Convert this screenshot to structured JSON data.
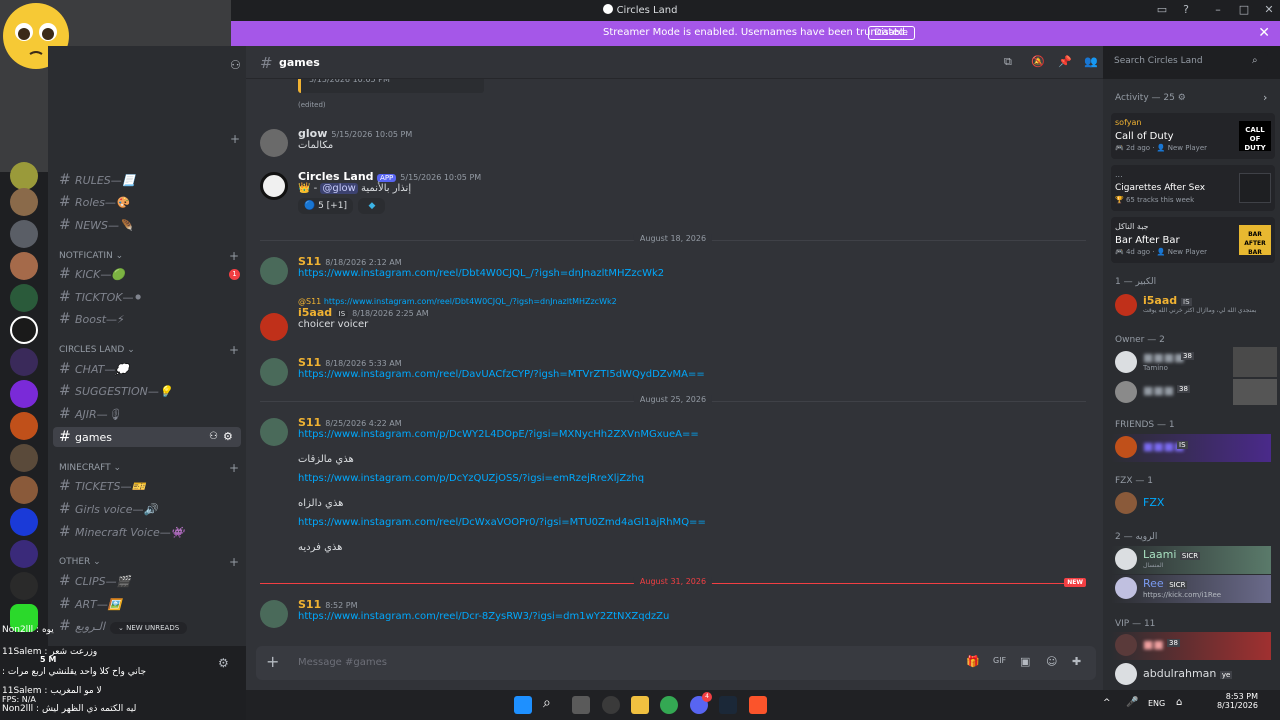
{
  "window": {
    "title": "Circles Land"
  },
  "banner": {
    "text": "Streamer Mode is enabled. Usernames have been truncated.",
    "button": "Disable"
  },
  "channel_list": {
    "categories": [
      {
        "name": "NOTFICATIN"
      },
      {
        "name": "CIRCLES LAND"
      },
      {
        "name": "MINECRAFT"
      },
      {
        "name": "OTHER"
      }
    ],
    "channels": [
      {
        "label": "RULES—📃"
      },
      {
        "label": "Roles—🎨"
      },
      {
        "label": "NEWS—🪶"
      },
      {
        "label": "KICK—🟢"
      },
      {
        "label": "TICKTOK—⚫"
      },
      {
        "label": "Boost—⚡"
      },
      {
        "label": "CHAT—💭"
      },
      {
        "label": "SUGGESTION—💡"
      },
      {
        "label": "AJIR—🎙"
      },
      {
        "label": "games"
      },
      {
        "label": "TICKETS—🎫"
      },
      {
        "label": "Girls voice—🔊"
      },
      {
        "label": "Minecraft Voice—👾"
      },
      {
        "label": "CLIPS—🎬"
      },
      {
        "label": "ART—🖼️"
      },
      {
        "label": "الـروبع"
      }
    ],
    "kick_badge": "1",
    "new_unreads": "NEW UNREADS"
  },
  "header": {
    "channel": "games",
    "search_placeholder": "Search Circles Land"
  },
  "messages": {
    "top_ts": "5/15/2026 10:05 PM",
    "edited": "(edited)",
    "m1": {
      "user": "glow",
      "ts": "5/15/2026 10:05 PM",
      "text": "مكالمات"
    },
    "m2": {
      "user": "Circles Land",
      "tag": "APP",
      "ts": "5/15/2026 10:05 PM",
      "text_mention": "@glow",
      "text_end": "إنذار بالأنمية",
      "reaction_count": "5 [+1]"
    },
    "div1": "August 18, 2026",
    "m3": {
      "user": "S11",
      "ts": "8/18/2026 2:12 AM",
      "link": "https://www.instagram.com/reel/Dbt4W0CJQL_/?igsh=dnJnazltMHZzcWk2"
    },
    "m4": {
      "reply_user": "@S11",
      "reply_link": "https://www.instagram.com/reel/Dbt4W0CJQL_/?igsh=dnJnazltMHZzcWk2",
      "user": "i5aad",
      "tag": "IS",
      "ts": "8/18/2026 2:25 AM",
      "text": "choicer voicer"
    },
    "m5": {
      "user": "S11",
      "ts": "8/18/2026 5:33 AM",
      "link": "https://www.instagram.com/reel/DavUACfzCYP/?igsh=MTVrZTI5dWQydDZvMA=="
    },
    "div2": "August 25, 2026",
    "m6": {
      "user": "S11",
      "ts": "8/25/2026 4:22 AM",
      "link1": "https://www.instagram.com/p/DcWY2L4DOpE/?igsi=MXNycHh2ZXVnMGxueA==",
      "t1": "هذي مالزقات",
      "link2": "https://www.instagram.com/p/DcYzQUZjOSS/?igsi=emRzejRreXljZzhq",
      "t2": "هذي دالزاه",
      "link3": "https://www.instagram.com/reel/DcWxaVOOPr0/?igsi=MTU0Zmd4aGl1ajRhMQ==",
      "t3": "هذي فرديه"
    },
    "div3": "August 31, 2026",
    "new_label": "NEW",
    "m7": {
      "user": "S11",
      "ts": "8:52 PM",
      "link": "https://www.instagram.com/reel/Dcr-8ZysRW3/?igsi=dm1wY2ZtNXZqdzZu"
    }
  },
  "composer": {
    "placeholder": "Message #games"
  },
  "members": {
    "activity": "Activity — 25",
    "cards": [
      {
        "user": "sofyan",
        "title": "Call of Duty",
        "meta": "2d ago",
        "badge": "New Player",
        "art": "CALL OF DUTY"
      },
      {
        "user": "...",
        "title": "Cigarettes After Sex",
        "meta": "65 tracks this week"
      },
      {
        "user": "جبة الناكل",
        "title": "Bar After Bar",
        "meta": "4d ago",
        "badge": "New Player",
        "art": "BAR AFTER BAR"
      }
    ],
    "groups": [
      {
        "name": "الكبير — 1"
      },
      {
        "name": "Owner — 2"
      },
      {
        "name": "FRIENDS — 1"
      },
      {
        "name": "FZX — 1"
      },
      {
        "name": "الرويه — 2"
      },
      {
        "name": "VIP — 11"
      }
    ],
    "rows": [
      {
        "name": "i5aad",
        "tag": "IS",
        "status": "بمنجدي الله لي، وماازال اكثر خرني الله يوقت"
      },
      {
        "name": "",
        "tag": "38",
        "status": "Tamino"
      },
      {
        "name": "",
        "tag": "38"
      },
      {
        "name": "",
        "tag": "IS"
      },
      {
        "name": "FZX"
      },
      {
        "name": "Laami",
        "tag": "SICR",
        "status": "المنسال"
      },
      {
        "name": "Ree",
        "tag": "SICR",
        "status": "https://kick.com/i1Ree"
      },
      {
        "name": "",
        "tag": "38"
      },
      {
        "name": "abdulrahman",
        "tag": "ye"
      }
    ]
  },
  "overlay": {
    "l1": "Non2lll : يوه",
    "l2": "11Salem : وزرعت شعر",
    "l3": ": جاني واح كلا واحد يقلنشي اربع مرات",
    "l4": "11Salem : لا مو المغريب",
    "l5": "Non2lll : ليه الكتمه ذي الظهر ليش",
    "count": "5 M",
    "fps": "FPS: N/A"
  },
  "taskbar": {
    "lang": "ENG",
    "time": "8:53 PM",
    "date": "8/31/2026",
    "steam_badge": "4"
  }
}
